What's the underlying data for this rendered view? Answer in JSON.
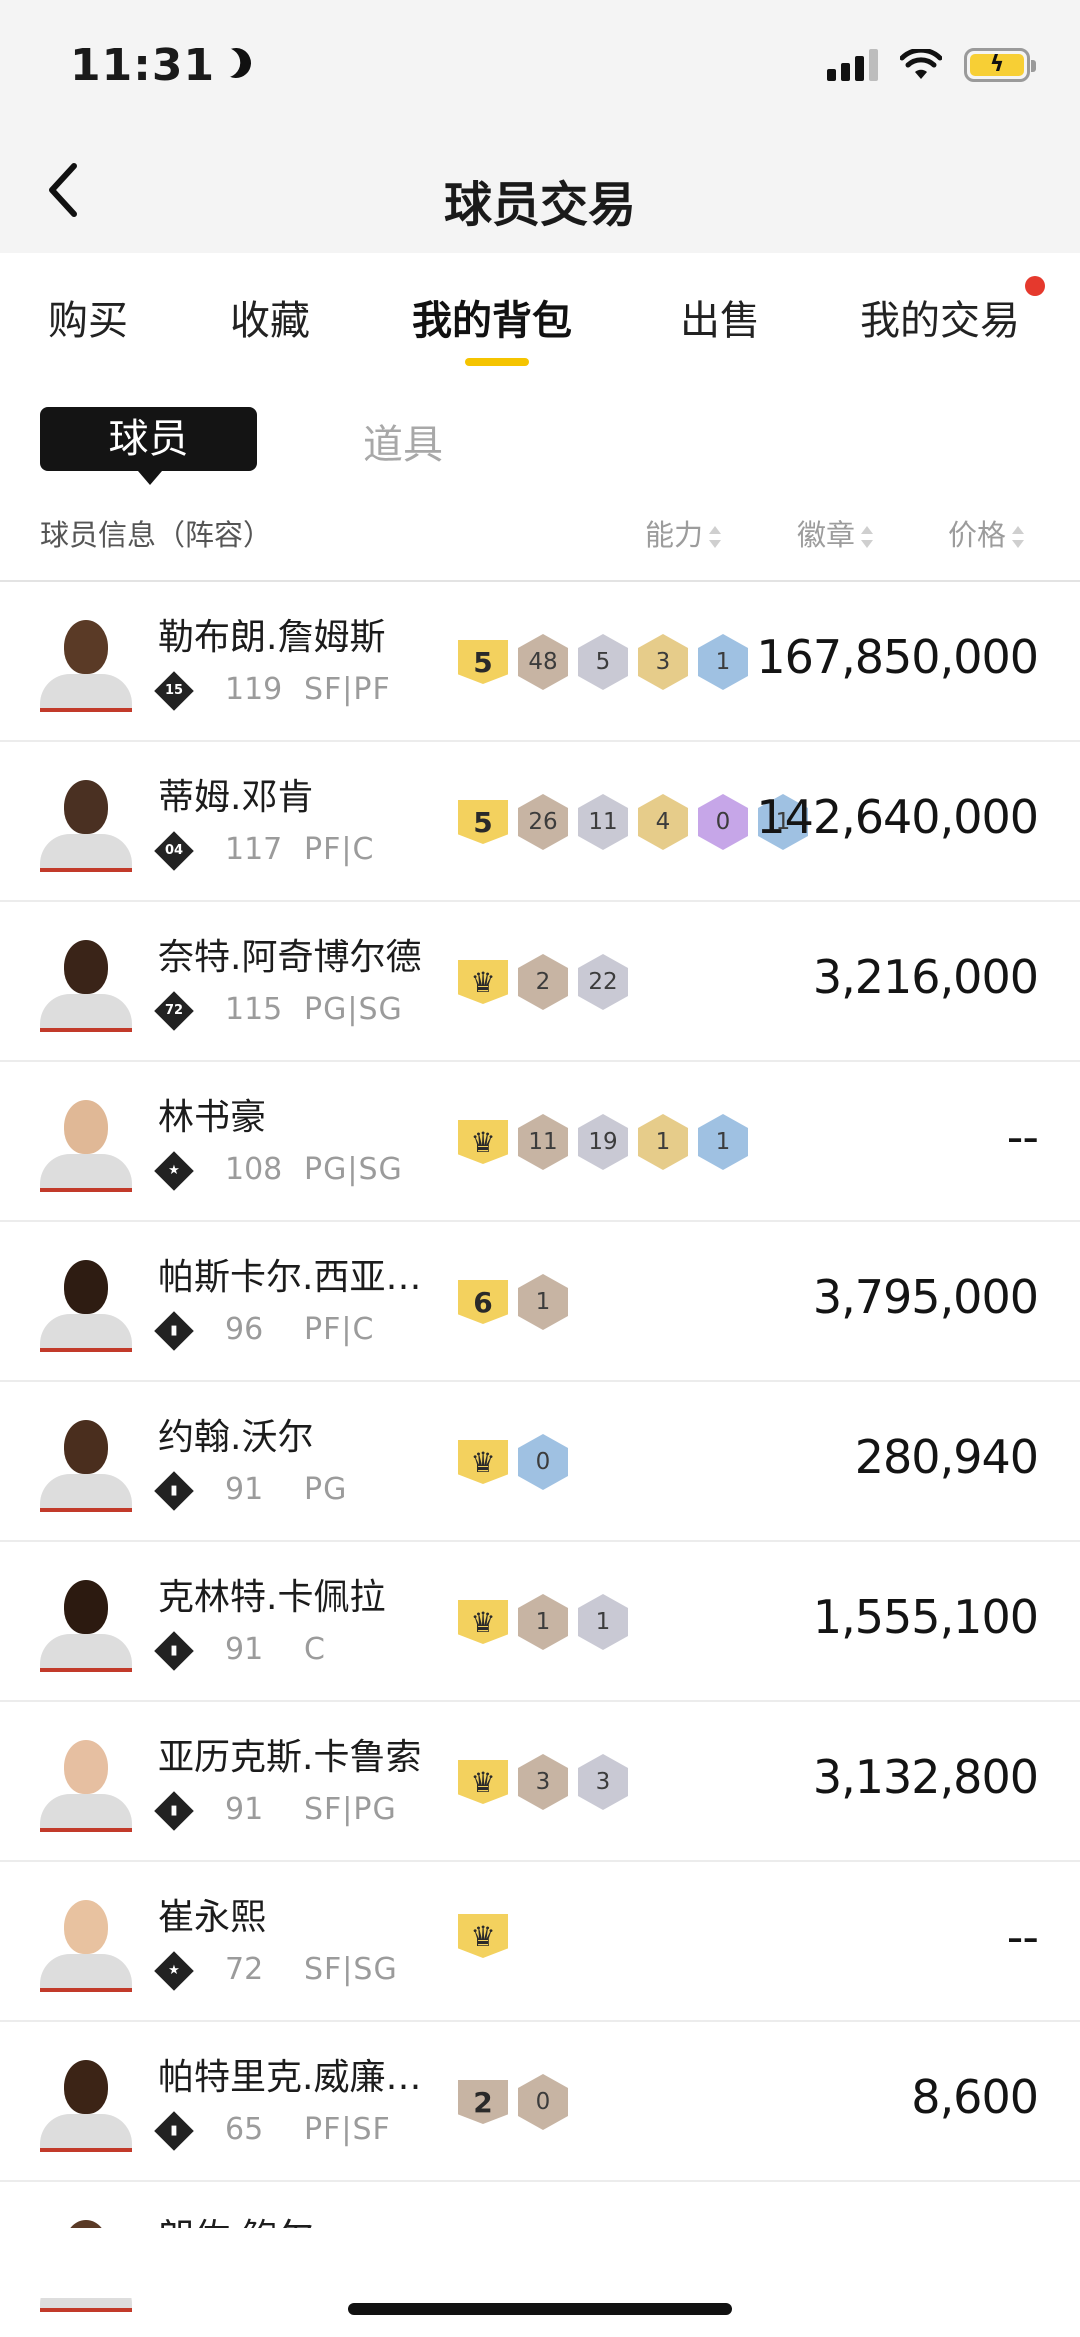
{
  "status": {
    "time": "11:31"
  },
  "nav": {
    "title": "球员交易"
  },
  "tabs": [
    "购买",
    "收藏",
    "我的背包",
    "出售",
    "我的交易"
  ],
  "subtabs": {
    "active": "球员",
    "inactive": "道具"
  },
  "header": {
    "info": "球员信息（阵容）",
    "ability": "能力",
    "badge": "徽章",
    "price": "价格"
  },
  "colors": {
    "accent": "#f5c400",
    "notify": "#e5392d",
    "tier_gold": "#f3d15e",
    "tier_bronze": "#c7b4a3"
  },
  "players": [
    {
      "name": "勒布朗.詹姆斯",
      "level": "15",
      "ovr": "119",
      "pos": "SF|PF",
      "tier": "5",
      "tier_type": "gold",
      "badges": [
        [
          "48",
          "bronze"
        ],
        [
          "5",
          "silver"
        ],
        [
          "3",
          "gold"
        ],
        [
          "1",
          "blue"
        ]
      ],
      "price": "167,850,000",
      "skin": "#5a3a26"
    },
    {
      "name": "蒂姆.邓肯",
      "level": "04",
      "ovr": "117",
      "pos": "PF|C",
      "tier": "5",
      "tier_type": "gold",
      "badges": [
        [
          "26",
          "bronze"
        ],
        [
          "11",
          "silver"
        ],
        [
          "4",
          "gold"
        ],
        [
          "0",
          "purple"
        ],
        [
          "1",
          "blue"
        ]
      ],
      "price": "142,640,000",
      "skin": "#4a3022"
    },
    {
      "name": "奈特.阿奇博尔德",
      "level": "72",
      "ovr": "115",
      "pos": "PG|SG",
      "tier": "♛",
      "tier_type": "gold",
      "badges": [
        [
          "2",
          "bronze"
        ],
        [
          "22",
          "silver"
        ]
      ],
      "price": "3,216,000",
      "skin": "#3a2418"
    },
    {
      "name": "林书豪",
      "level": "★",
      "ovr": "108",
      "pos": "PG|SG",
      "tier": "♛",
      "tier_type": "gold",
      "badges": [
        [
          "11",
          "bronze"
        ],
        [
          "19",
          "silver"
        ],
        [
          "1",
          "gold"
        ],
        [
          "1",
          "blue"
        ]
      ],
      "price": "--",
      "skin": "#e0b896"
    },
    {
      "name": "帕斯卡尔.西亚…",
      "level": "▮",
      "ovr": "96",
      "pos": "PF|C",
      "tier": "6",
      "tier_type": "gold",
      "badges": [
        [
          "1",
          "bronze"
        ]
      ],
      "price": "3,795,000",
      "skin": "#2e1c12"
    },
    {
      "name": "约翰.沃尔",
      "level": "▮",
      "ovr": "91",
      "pos": "PG",
      "tier": "♛",
      "tier_type": "gold",
      "badges": [
        [
          "0",
          "blue"
        ]
      ],
      "price": "280,940",
      "skin": "#4a2e1e"
    },
    {
      "name": "克林特.卡佩拉",
      "level": "▮",
      "ovr": "91",
      "pos": "C",
      "tier": "♛",
      "tier_type": "gold",
      "badges": [
        [
          "1",
          "bronze"
        ],
        [
          "1",
          "silver"
        ]
      ],
      "price": "1,555,100",
      "skin": "#2c1a10"
    },
    {
      "name": "亚历克斯.卡鲁索",
      "level": "▮",
      "ovr": "91",
      "pos": "SF|PG",
      "tier": "♛",
      "tier_type": "gold",
      "badges": [
        [
          "3",
          "bronze"
        ],
        [
          "3",
          "silver"
        ]
      ],
      "price": "3,132,800",
      "skin": "#e6bfa1"
    },
    {
      "name": "崔永熙",
      "level": "★",
      "ovr": "72",
      "pos": "SF|SG",
      "tier": "♛",
      "tier_type": "gold",
      "badges": [],
      "price": "--",
      "skin": "#e8c2a0"
    },
    {
      "name": "帕特里克.威廉…",
      "level": "▮",
      "ovr": "65",
      "pos": "PF|SF",
      "tier": "2",
      "tier_type": "bronze",
      "badges": [
        [
          "0",
          "bronze"
        ]
      ],
      "price": "8,600",
      "skin": "#3c2416"
    },
    {
      "name": "朗佐.鲍尔",
      "level": "",
      "ovr": "",
      "pos": "",
      "tier": "",
      "tier_type": "gold",
      "badges": [],
      "price": "",
      "skin": "#5a3a26"
    }
  ]
}
